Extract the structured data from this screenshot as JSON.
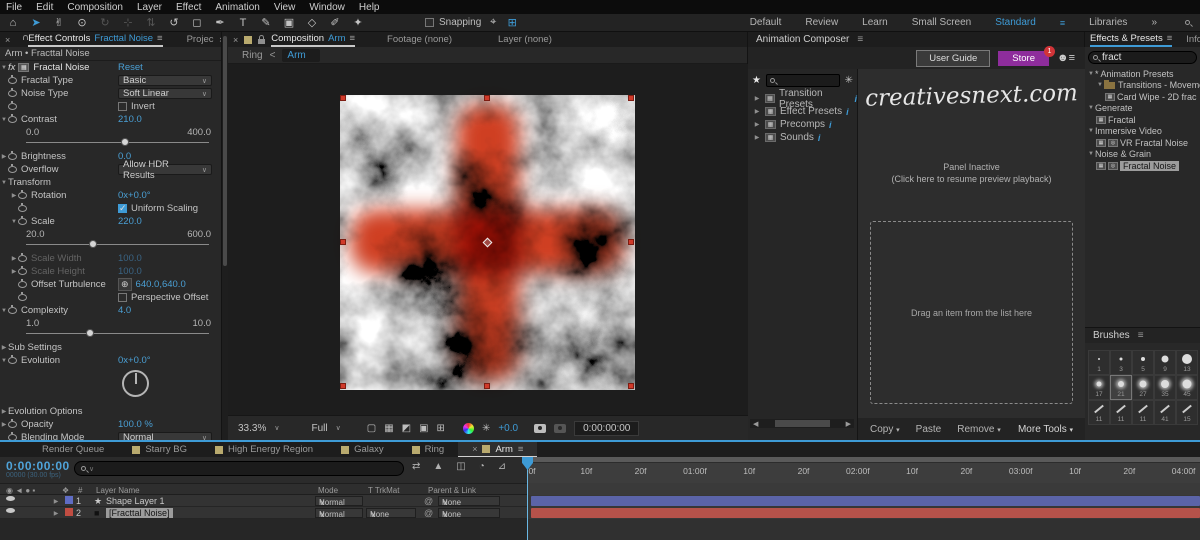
{
  "colors": {
    "accent": "#3e9bd6",
    "value_blue": "#4a9fd4",
    "store_purple": "#8e2d9c",
    "badge_red": "#d13438",
    "layer1_bar": "#5b64a8",
    "layer2_bar": "#b5524a",
    "render_green": "#2f9e2f",
    "label1": "#5f6cc4",
    "label2": "#c14d42",
    "comp_square": "#b9aa6e"
  },
  "menu_bar": {
    "items": [
      "File",
      "Edit",
      "Composition",
      "Layer",
      "Effect",
      "Animation",
      "View",
      "Window",
      "Help"
    ]
  },
  "toolbar": {
    "tools": [
      {
        "name": "home-tool",
        "glyph": "⌂"
      },
      {
        "name": "selection-tool",
        "glyph": "➤",
        "active": true
      },
      {
        "name": "hand-tool",
        "glyph": "✌"
      },
      {
        "name": "zoom-tool",
        "glyph": "⊙"
      },
      {
        "name": "orbit-camera-tool",
        "glyph": "↻",
        "disabled": true
      },
      {
        "name": "pan-camera-tool",
        "glyph": "⊹",
        "disabled": true
      },
      {
        "name": "dolly-camera-tool",
        "glyph": "⇅",
        "disabled": true
      },
      {
        "name": "rotation-tool",
        "glyph": "↺"
      },
      {
        "name": "mask-tool",
        "glyph": "◻"
      },
      {
        "name": "pen-tool",
        "glyph": "✒"
      },
      {
        "name": "type-tool",
        "glyph": "T"
      },
      {
        "name": "brush-tool",
        "glyph": "✎"
      },
      {
        "name": "stamp-tool",
        "glyph": "▣"
      },
      {
        "name": "eraser-tool",
        "glyph": "◇"
      },
      {
        "name": "rotobrush-tool",
        "glyph": "✐"
      },
      {
        "name": "puppet-tool",
        "glyph": "✦"
      }
    ],
    "snapping_label": "Snapping",
    "workspaces": [
      "Default",
      "Review",
      "Learn",
      "Small Screen",
      "Standard",
      "Libraries"
    ],
    "active_workspace": "Standard"
  },
  "effect_controls": {
    "tab": "Effect Controls",
    "tab_target": "Fracttal Noise",
    "neighbor_tab": "Projec",
    "overflow_chevrons": "»",
    "breadcrumb": "Arm • Fracttal Noise",
    "rows": [
      {
        "t": "fx",
        "label": "Fractal Noise",
        "value": "Reset"
      },
      {
        "t": "prop",
        "sw": true,
        "label": "Fractal Type",
        "control": "dropdown",
        "value": "Basic"
      },
      {
        "t": "prop",
        "sw": true,
        "label": "Noise Type",
        "control": "dropdown",
        "value": "Soft Linear"
      },
      {
        "t": "prop",
        "sw": true,
        "label": "",
        "control": "checkbox",
        "value": "Invert",
        "checked": false
      },
      {
        "t": "prop",
        "tw": "v",
        "sw": true,
        "label": "Contrast",
        "control": "blue",
        "value": "210.0"
      },
      {
        "t": "slider",
        "min": "0.0",
        "max": "400.0",
        "pos": 0.52
      },
      {
        "t": "prop",
        "tw": ">",
        "sw": true,
        "label": "Brightness",
        "control": "blue",
        "value": "0.0"
      },
      {
        "t": "prop",
        "sw": true,
        "label": "Overflow",
        "control": "dropdown",
        "value": "Allow HDR Results"
      },
      {
        "t": "group",
        "tw": "v",
        "label": "Transform"
      },
      {
        "t": "prop",
        "tw": ">",
        "sw": true,
        "label": "Rotation",
        "control": "blue",
        "value": "0x+0.0°",
        "ind": 1
      },
      {
        "t": "prop",
        "sw": true,
        "label": "",
        "control": "checkbox",
        "value": "Uniform Scaling",
        "checked": true,
        "ind": 1
      },
      {
        "t": "prop",
        "tw": "v",
        "sw": true,
        "label": "Scale",
        "control": "blue",
        "value": "220.0",
        "ind": 1
      },
      {
        "t": "slider",
        "min": "20.0",
        "max": "600.0",
        "pos": 0.345,
        "ind": 1
      },
      {
        "t": "prop",
        "tw": ">",
        "sw": true,
        "label": "Scale Width",
        "control": "blue",
        "value": "100.0",
        "grayed": true,
        "ind": 1
      },
      {
        "t": "prop",
        "tw": ">",
        "sw": true,
        "label": "Scale Height",
        "control": "blue",
        "value": "100.0",
        "grayed": true,
        "ind": 1
      },
      {
        "t": "prop",
        "sw": true,
        "label": "Offset Turbulence",
        "control": "point",
        "value": "640.0,640.0",
        "ind": 1
      },
      {
        "t": "prop",
        "sw": true,
        "label": "",
        "control": "checkbox",
        "value": "Perspective Offset",
        "checked": false,
        "ind": 1
      },
      {
        "t": "prop",
        "tw": "v",
        "sw": true,
        "label": "Complexity",
        "control": "blue",
        "value": "4.0"
      },
      {
        "t": "slider",
        "min": "1.0",
        "max": "10.0",
        "pos": 0.33
      },
      {
        "t": "group",
        "tw": ">",
        "label": "Sub Settings"
      },
      {
        "t": "prop",
        "tw": "v",
        "sw": true,
        "label": "Evolution",
        "control": "blue",
        "value": "0x+0.0°"
      },
      {
        "t": "dial"
      },
      {
        "t": "group",
        "tw": ">",
        "label": "Evolution Options"
      },
      {
        "t": "prop",
        "tw": ">",
        "sw": true,
        "label": "Opacity",
        "control": "blue",
        "value": "100.0 %"
      },
      {
        "t": "prop",
        "sw": true,
        "label": "Blending Mode",
        "control": "dropdown",
        "value": "Normal"
      }
    ]
  },
  "composition": {
    "tab": "Composition",
    "tab_target": "Arm",
    "tab2": "Footage (none)",
    "tab3": "Layer (none)",
    "crumb_parent": "Ring",
    "crumb_sep": "<",
    "crumb_current": "Arm",
    "bottom": {
      "zoom": "33.3%",
      "resolution": "Full",
      "exposure": "+0.0",
      "timecode": "0:00:00:00"
    }
  },
  "animation_composer": {
    "title": "Animation Composer",
    "user_guide": "User Guide",
    "store": "Store",
    "store_badge": "1",
    "tree": [
      {
        "label": "Transition Presets"
      },
      {
        "label": "Effect Presets"
      },
      {
        "label": "Precomps"
      },
      {
        "label": "Sounds"
      }
    ],
    "watermark": "creativesnext.com",
    "inactive_title": "Panel Inactive",
    "inactive_sub": "(Click here to resume preview playback)",
    "drop_hint": "Drag an item from the list here",
    "copy": "Copy",
    "paste": "Paste",
    "remove": "Remove",
    "more_tools": "More Tools"
  },
  "effects_presets": {
    "tab": "Effects & Presets",
    "info_tab": "Info",
    "search": "fract",
    "tree": [
      {
        "label": "* Animation Presets",
        "level": 0,
        "tw": "v"
      },
      {
        "label": "Transitions - Movemen",
        "level": 1,
        "tw": "v",
        "icon": "folder"
      },
      {
        "label": "Card Wipe - 2D frac",
        "level": 2,
        "icon": "preset"
      },
      {
        "label": "Generate",
        "level": 0,
        "tw": "v"
      },
      {
        "label": "Fractal",
        "level": 1,
        "icon": "effect"
      },
      {
        "label": "Immersive Video",
        "level": 0,
        "tw": "v"
      },
      {
        "label": "VR Fractal Noise",
        "level": 1,
        "icon": "effect2"
      },
      {
        "label": "Noise & Grain",
        "level": 0,
        "tw": "v"
      },
      {
        "label": "Fractal Noise",
        "level": 1,
        "icon": "effect2",
        "selected": true
      }
    ]
  },
  "brushes": {
    "title": "Brushes",
    "cells": [
      {
        "n": "1",
        "kind": "hard",
        "size": 2
      },
      {
        "n": "3",
        "kind": "hard",
        "size": 3
      },
      {
        "n": "5",
        "kind": "hard",
        "size": 4
      },
      {
        "n": "9",
        "kind": "hard",
        "size": 7
      },
      {
        "n": "13",
        "kind": "hard",
        "size": 10
      },
      {
        "n": "17",
        "kind": "soft",
        "size": 5
      },
      {
        "n": "21",
        "kind": "soft",
        "size": 6,
        "sel": true
      },
      {
        "n": "27",
        "kind": "soft",
        "size": 7
      },
      {
        "n": "35",
        "kind": "soft",
        "size": 8
      },
      {
        "n": "45",
        "kind": "soft",
        "size": 9
      },
      {
        "n": "11",
        "kind": "slash"
      },
      {
        "n": "11",
        "kind": "slash"
      },
      {
        "n": "11",
        "kind": "slash"
      },
      {
        "n": "41",
        "kind": "slash"
      },
      {
        "n": "15",
        "kind": "slash"
      }
    ]
  },
  "timeline": {
    "tabs": [
      {
        "label": "Render Queue",
        "square": false
      },
      {
        "label": "Starry BG",
        "square": true
      },
      {
        "label": "High Energy Region",
        "square": true
      },
      {
        "label": "Galaxy",
        "square": true
      },
      {
        "label": "Ring",
        "square": true
      },
      {
        "label": "Arm",
        "square": true,
        "active": true,
        "close": true,
        "menu": true
      }
    ],
    "timecode": "0:00:00:00",
    "timecode_sub": "00000 (30.00 fps)",
    "ruler_ticks": [
      "0f",
      "10f",
      "20f",
      "01:00f",
      "10f",
      "20f",
      "02:00f",
      "10f",
      "20f",
      "03:00f",
      "10f",
      "20f",
      "04:00f"
    ],
    "columns": {
      "layer_name": "Layer Name",
      "mode": "Mode",
      "trkmat": "T TrkMat",
      "parent": "Parent & Link"
    },
    "layers": [
      {
        "num": "1",
        "name": "Shape Layer 1",
        "mode": "Normal",
        "trkmat": "",
        "parent": "None",
        "chip": "#5f6cc4",
        "icon": "star",
        "selected": false,
        "bar": "#5b64a8"
      },
      {
        "num": "2",
        "name": "[Fracttal Noise]",
        "mode": "Normal",
        "trkmat": "None",
        "parent": "None",
        "chip": "#c14d42",
        "icon": "solid",
        "selected": true,
        "bar": "#b5524a"
      }
    ]
  }
}
